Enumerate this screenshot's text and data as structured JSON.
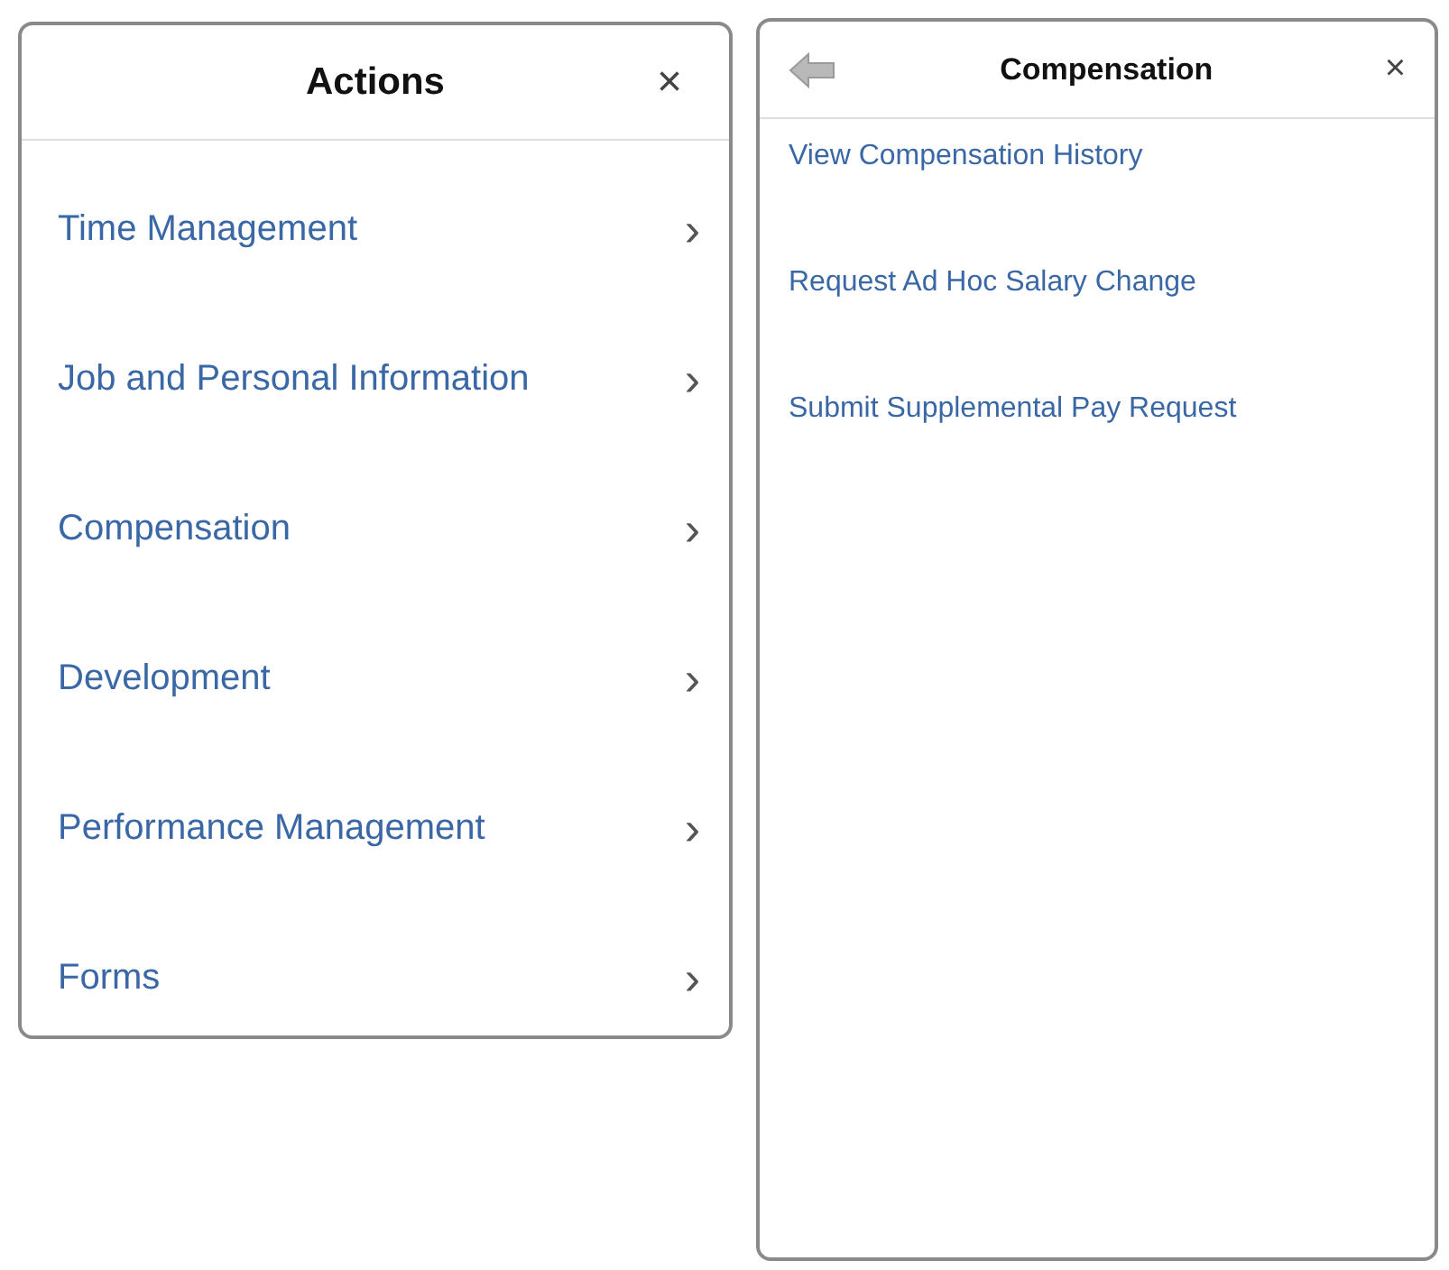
{
  "actions_panel": {
    "title": "Actions",
    "close": "×",
    "items": [
      {
        "label": "Time Management",
        "chevron": "›"
      },
      {
        "label": "Job and Personal Information",
        "chevron": "›"
      },
      {
        "label": "Compensation",
        "chevron": "›"
      },
      {
        "label": "Development",
        "chevron": "›"
      },
      {
        "label": "Performance Management",
        "chevron": "›"
      },
      {
        "label": "Forms",
        "chevron": "›"
      }
    ]
  },
  "compensation_panel": {
    "title": "Compensation",
    "close": "×",
    "items": [
      {
        "label": "View Compensation History"
      },
      {
        "label": "Request Ad Hoc Salary Change"
      },
      {
        "label": "Submit Supplemental Pay Request"
      }
    ]
  }
}
